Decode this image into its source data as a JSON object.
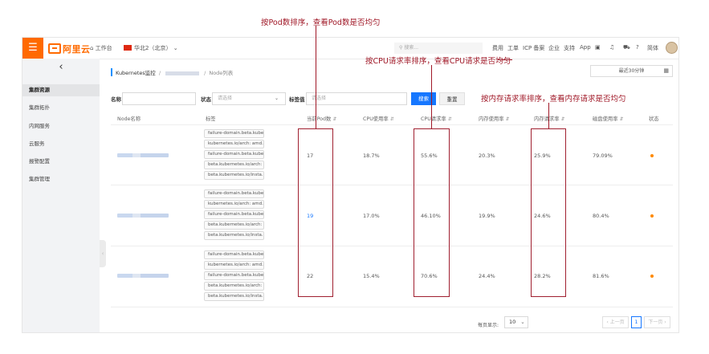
{
  "annotations": {
    "pod": "按Pod数排序，查看Pod数是否均匀",
    "cpu": "按CPU请求率排序，查看CPU请求是否均匀",
    "mem": "按内存请求率排序，查看内存请求是否均匀"
  },
  "topbar": {
    "logo": "阿里云",
    "workbench": "工作台",
    "region": "华北2（北京）",
    "search_placeholder": "搜索...",
    "links": [
      "费用",
      "工单",
      "ICP 备案",
      "企业",
      "支持",
      "App"
    ],
    "lang": "简体"
  },
  "sidebar": {
    "items": [
      "集群资源",
      "集群拓扑",
      "内网服务",
      "云服务",
      "报警配置",
      "集群管理"
    ]
  },
  "breadcrumb": {
    "root": "Kubernetes监控",
    "current": "Node列表"
  },
  "time_range": "最近30分钟",
  "filters": {
    "name_label": "名称",
    "status_label": "状态",
    "status_placeholder": "请选择",
    "tag_label": "标签值",
    "tag_placeholder": "请选择",
    "search_btn": "搜索",
    "reset_btn": "重置"
  },
  "table": {
    "headers": [
      "Node名称",
      "标签",
      "当前Pod数",
      "CPU使用率",
      "CPU请求率",
      "内存使用率",
      "内存请求率",
      "磁盘使用率",
      "状态"
    ],
    "tags": [
      "failure-domain.beta.kube...",
      "kubernetes.io/arch: amd...",
      "failure-domain.beta.kube...",
      "beta.kubernetes.io/arch: ...",
      "beta.kubernetes.io/insta..."
    ],
    "rows": [
      {
        "pods": "17",
        "cpu_use": "18.7%",
        "cpu_req": "55.6%",
        "mem_use": "20.3%",
        "mem_req": "25.9%",
        "disk": "79.09%"
      },
      {
        "pods": "19",
        "cpu_use": "17.0%",
        "cpu_req": "46.10%",
        "mem_use": "19.9%",
        "mem_req": "24.6%",
        "disk": "80.4%"
      },
      {
        "pods": "22",
        "cpu_use": "15.4%",
        "cpu_req": "70.6%",
        "mem_use": "24.4%",
        "mem_req": "28.2%",
        "disk": "81.6%"
      }
    ]
  },
  "pager": {
    "page_size_label": "每页显示:",
    "page_size": "10",
    "prev": "上一页",
    "current": "1",
    "next": "下一页"
  },
  "colors": {
    "brand": "#ff6a00",
    "primary": "#1677ff",
    "annotation": "#a01827",
    "status_dot": "#ff8a00"
  }
}
